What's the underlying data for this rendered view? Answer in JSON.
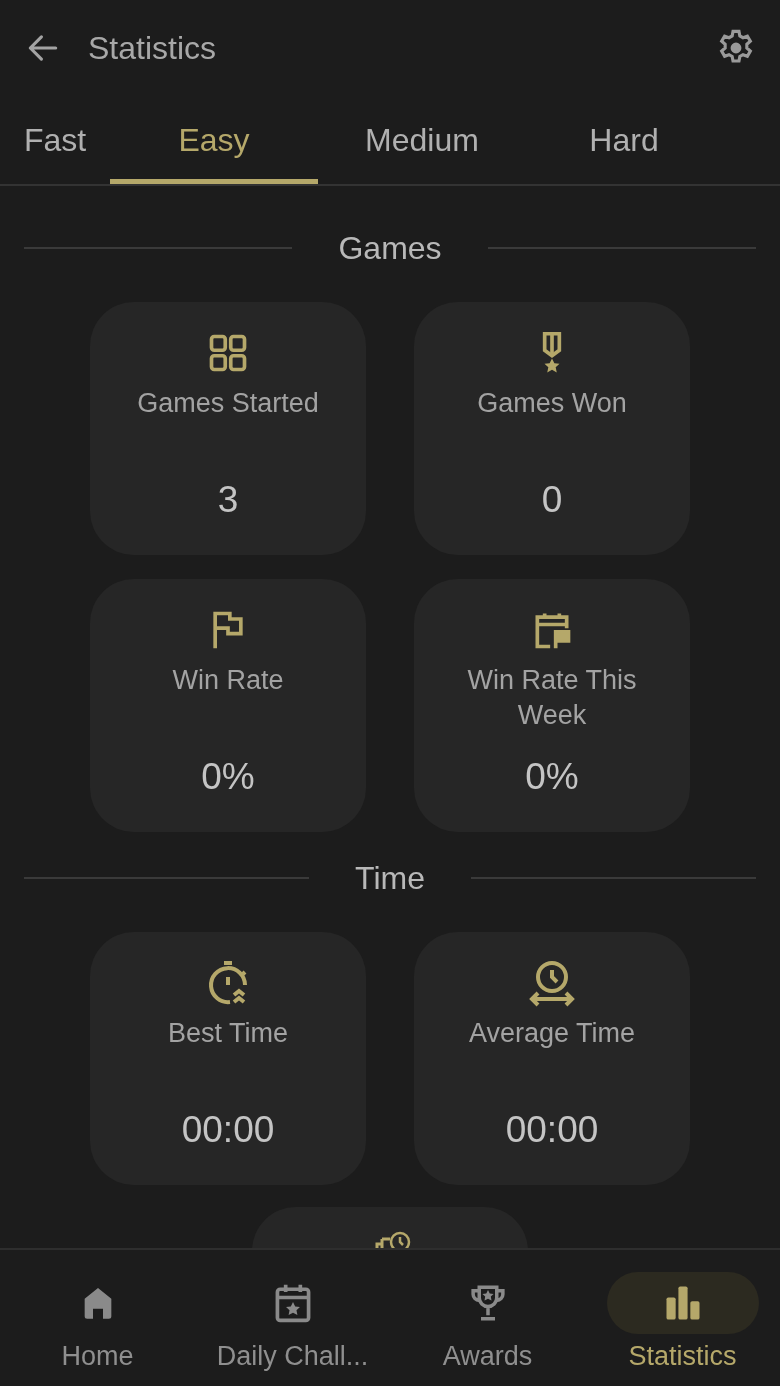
{
  "header": {
    "title": "Statistics"
  },
  "tabs": [
    {
      "label": "Fast",
      "selected": false
    },
    {
      "label": "Easy",
      "selected": true
    },
    {
      "label": "Medium",
      "selected": false
    },
    {
      "label": "Hard",
      "selected": false
    }
  ],
  "sections": [
    {
      "title": "Games",
      "cards": [
        {
          "label": "Games Started",
          "value": "3"
        },
        {
          "label": "Games Won",
          "value": "0"
        },
        {
          "label": "Win Rate",
          "value": "0%"
        },
        {
          "label": "Win Rate This Week",
          "value": "0%"
        }
      ]
    },
    {
      "title": "Time",
      "cards": [
        {
          "label": "Best Time",
          "value": "00:00"
        },
        {
          "label": "Average Time",
          "value": "00:00"
        }
      ]
    }
  ],
  "bottom_nav": [
    {
      "label": "Home",
      "selected": false
    },
    {
      "label": "Daily Chall...",
      "selected": false
    },
    {
      "label": "Awards",
      "selected": false
    },
    {
      "label": "Statistics",
      "selected": true
    }
  ]
}
